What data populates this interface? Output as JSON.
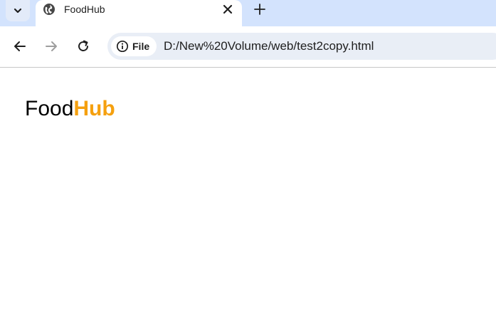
{
  "browser": {
    "tab": {
      "title": "FoodHub",
      "favicon": "globe-icon"
    },
    "toolbar": {
      "back": "arrow-left-icon",
      "forward": "arrow-right-icon",
      "reload": "reload-icon"
    },
    "omnibox": {
      "chip_label": "File",
      "chip_icon": "info-icon",
      "url": "D:/New%20Volume/web/test2copy.html"
    }
  },
  "page": {
    "logo": {
      "part1": "Food",
      "part2": "Hub"
    }
  },
  "colors": {
    "tabstrip": "#d3e3fd",
    "omnibox": "#e9eef6",
    "accent": "#f5a00f"
  }
}
